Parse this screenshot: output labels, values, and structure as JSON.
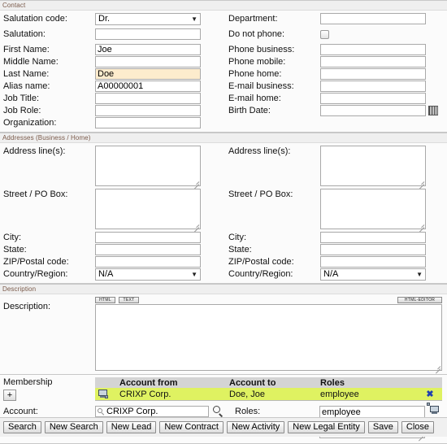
{
  "sections": {
    "contact": {
      "title": "Contact",
      "left_fields": [
        {
          "label": "Salutation code:",
          "type": "select",
          "value": "Dr."
        },
        {
          "label": "Salutation:",
          "type": "text",
          "value": ""
        },
        {
          "label": "First Name:",
          "type": "text",
          "value": "Joe"
        },
        {
          "label": "Middle Name:",
          "type": "text",
          "value": ""
        },
        {
          "label": "Last Name:",
          "type": "text",
          "value": "Doe",
          "highlight": true
        },
        {
          "label": "Alias name:",
          "type": "text",
          "value": "A00000001"
        },
        {
          "label": "Job Title:",
          "type": "text",
          "value": ""
        },
        {
          "label": "Job Role:",
          "type": "text",
          "value": ""
        },
        {
          "label": "Organization:",
          "type": "text",
          "value": ""
        }
      ],
      "right_fields": [
        {
          "label": "Department:",
          "type": "text",
          "value": ""
        },
        {
          "label": "Do not phone:",
          "type": "checkbox",
          "checked": false
        },
        {
          "label": "Phone business:",
          "type": "text",
          "value": ""
        },
        {
          "label": "Phone mobile:",
          "type": "text",
          "value": ""
        },
        {
          "label": "Phone home:",
          "type": "text",
          "value": ""
        },
        {
          "label": "E-mail business:",
          "type": "text",
          "value": ""
        },
        {
          "label": "E-mail home:",
          "type": "text",
          "value": ""
        },
        {
          "label": "Birth Date:",
          "type": "date",
          "value": ""
        }
      ]
    },
    "addresses": {
      "title": "Addresses (Business / Home)",
      "left_fields": [
        {
          "label": "Address line(s):",
          "type": "textarea",
          "value": ""
        },
        {
          "label": "Street / PO Box:",
          "type": "textarea",
          "value": ""
        },
        {
          "label": "City:",
          "type": "text",
          "value": ""
        },
        {
          "label": "State:",
          "type": "text",
          "value": ""
        },
        {
          "label": "ZIP/Postal code:",
          "type": "text",
          "value": ""
        },
        {
          "label": "Country/Region:",
          "type": "select",
          "value": "N/A"
        }
      ],
      "right_fields": [
        {
          "label": "Address line(s):",
          "type": "textarea",
          "value": ""
        },
        {
          "label": "Street / PO Box:",
          "type": "textarea",
          "value": ""
        },
        {
          "label": "City:",
          "type": "text",
          "value": ""
        },
        {
          "label": "State:",
          "type": "text",
          "value": ""
        },
        {
          "label": "ZIP/Postal code:",
          "type": "text",
          "value": ""
        },
        {
          "label": "Country/Region:",
          "type": "select",
          "value": "N/A"
        }
      ]
    },
    "description": {
      "title": "Description",
      "label": "Description:",
      "toolbar": {
        "html_label": "HTML",
        "text_label": "TEXT",
        "editor_label": "HTML-EDITOR"
      },
      "value": ""
    },
    "membership": {
      "label": "Membership",
      "add_label": "+",
      "columns": [
        "",
        "Account from",
        "Account to",
        "Roles",
        ""
      ],
      "rows": [
        {
          "icon": "monitor-icon",
          "account_from": "CRIXP Corp.",
          "account_to": "Doe, Joe",
          "roles": "employee",
          "delete_label": "✖"
        }
      ]
    },
    "account_detail": {
      "account_label": "Account:",
      "account_value": "CRIXP Corp.",
      "roles_label": "Roles:",
      "roles_value": "employee"
    }
  },
  "buttons": [
    {
      "label": "Search"
    },
    {
      "label": "New Search"
    },
    {
      "label": "New Lead"
    },
    {
      "label": "New Contract"
    },
    {
      "label": "New Activity"
    },
    {
      "label": "New Legal Entity"
    },
    {
      "label": "Save"
    },
    {
      "label": "Close"
    }
  ],
  "colors": {
    "highlight_field": "#fdeccd",
    "grid_row_selected": "#dff261",
    "grid_header": "#d4d4d4",
    "section_title_text": "#7a5a4a"
  }
}
